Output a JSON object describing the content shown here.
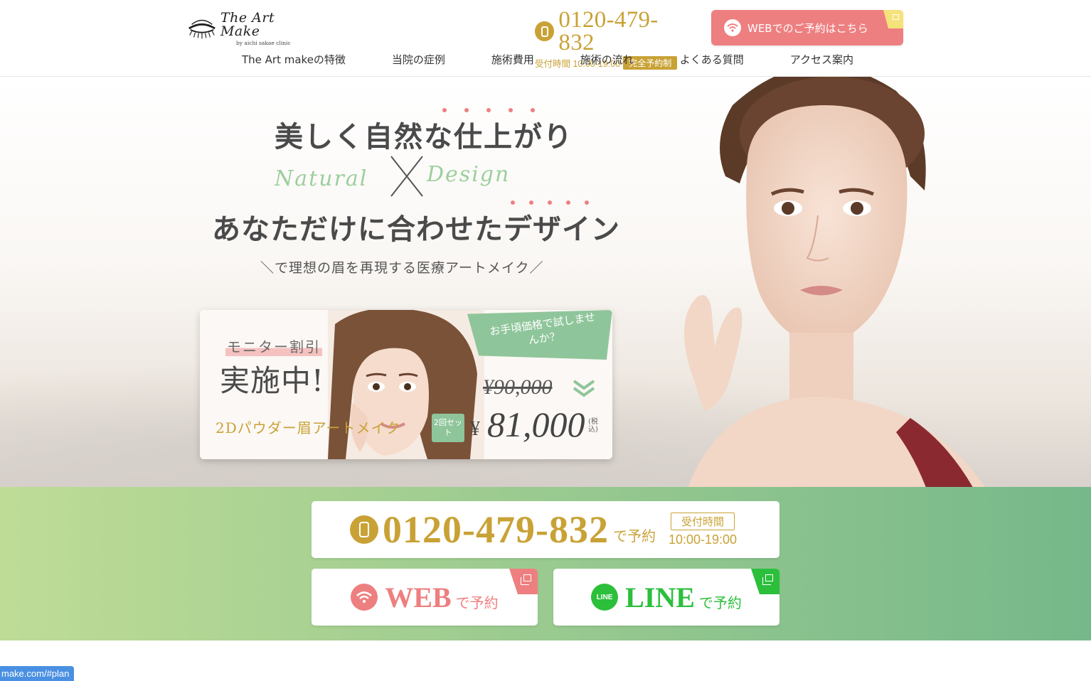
{
  "header": {
    "logo": {
      "main": "The Art Make",
      "sub": "by aichi sakae clinic"
    },
    "phone": {
      "number": "0120-479-832",
      "hours": "受付時間 10:00-19:00",
      "badge": "完全予約制"
    },
    "web_button": "WEBでのご予約はこちら",
    "nav": [
      "The Art makeの特徴",
      "当院の症例",
      "施術費用",
      "施術の流れ",
      "よくある質問",
      "アクセス案内"
    ]
  },
  "hero": {
    "title_line1": "美しく自然な仕上がり",
    "word_left": "Natural",
    "word_right": "Design",
    "title_line2": "あなただけに合わせたデザイン",
    "subtitle": "＼で理想の眉を再現する医療アートメイク／",
    "campaign": {
      "monitor": "モニター割引",
      "headline": "実施中!",
      "tag": "お手頃価格で試しませんか？",
      "product": "2Dパウダー眉アートメイク",
      "set_label": "2回セット",
      "old_price": "¥90,000",
      "currency": "¥",
      "price": "81,000",
      "tax": "(税込)"
    }
  },
  "cta": {
    "tel_number": "0120-479-832",
    "tel_suffix": "で予約",
    "hours_label": "受付時間",
    "hours_time": "10:00-19:00",
    "web_label": "WEB",
    "web_suffix": "で予約",
    "line_icon_text": "LINE",
    "line_label": "LINE",
    "line_suffix": "で予約"
  },
  "status_bar": {
    "url": "make.com/#plan"
  },
  "colors": {
    "gold": "#c9a236",
    "pink": "#ee7f80",
    "green": "#8fc59a",
    "line_green": "#2cbf3c",
    "band_start": "#bedc96",
    "band_end": "#76b88a"
  }
}
